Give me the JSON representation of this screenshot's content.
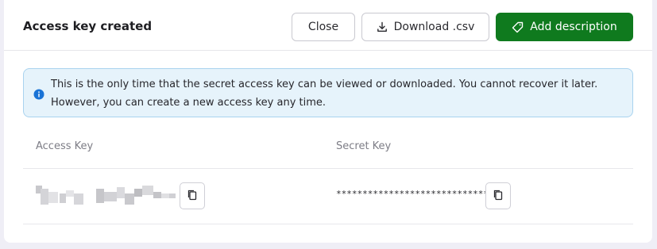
{
  "header": {
    "title": "Access key created",
    "close_label": "Close",
    "download_label": "Download .csv",
    "add_description_label": "Add description"
  },
  "alert": {
    "text": "This is the only time that the secret access key can be viewed or downloaded. You cannot recover it later. However, you can create a new access key any time."
  },
  "table": {
    "columns": [
      "Access Key",
      "Secret Key"
    ],
    "secret_key_masked": "******************************",
    "access_key_note": "blurred"
  },
  "icons": {
    "download": "download-icon",
    "tag": "tag-icon",
    "info": "info-icon",
    "copy": "copy-icon"
  },
  "colors": {
    "primary": "#0f7a1e",
    "info_bg": "#e6f3fb",
    "info_border": "#a9d3ef",
    "info_icon": "#1a73d6"
  }
}
